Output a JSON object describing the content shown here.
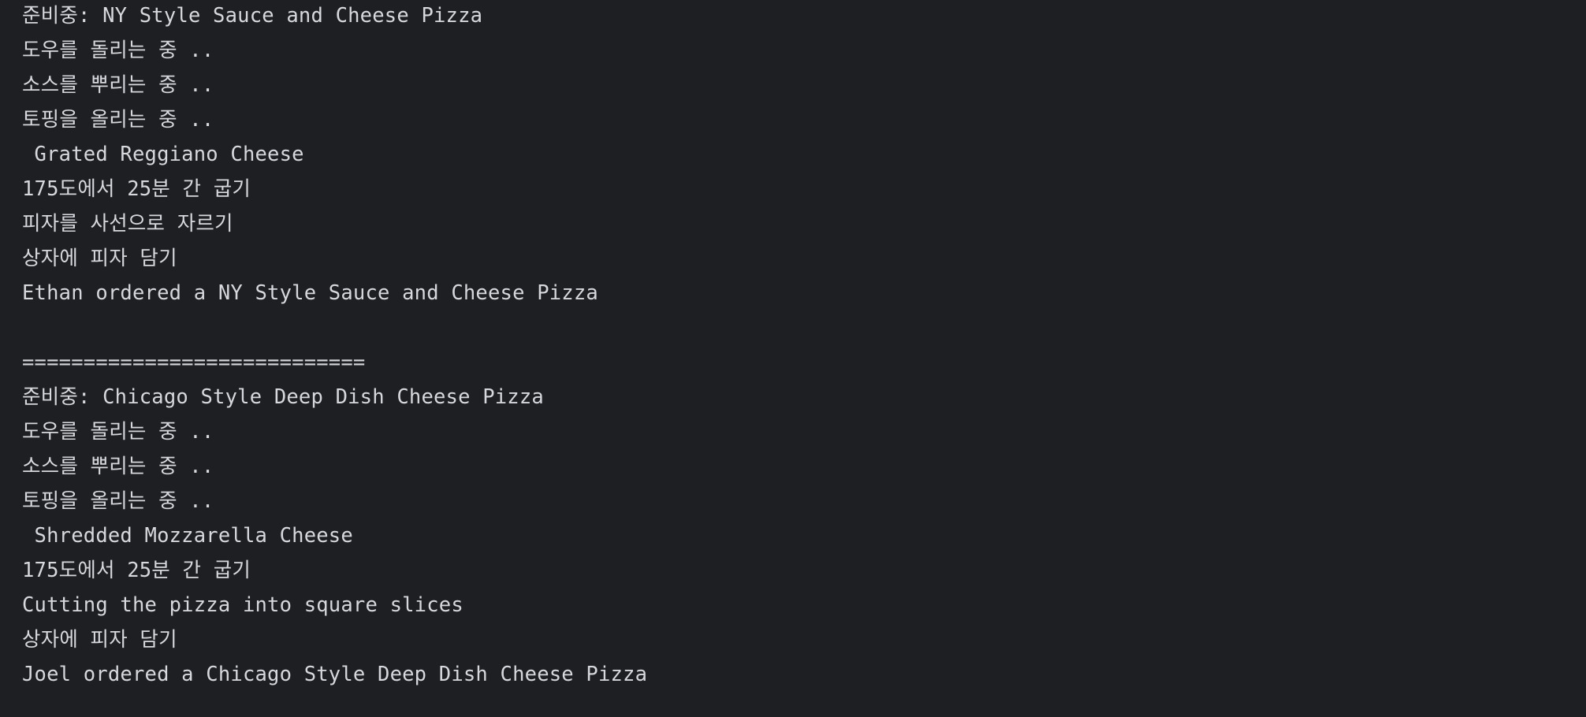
{
  "console": {
    "lines": [
      "준비중: NY Style Sauce and Cheese Pizza",
      "도우를 돌리는 중 ..",
      "소스를 뿌리는 중 ..",
      "토핑을 올리는 중 ..",
      " Grated Reggiano Cheese",
      "175도에서 25분 간 굽기",
      "피자를 사선으로 자르기",
      "상자에 피자 담기",
      "Ethan ordered a NY Style Sauce and Cheese Pizza",
      "",
      "============================",
      "준비중: Chicago Style Deep Dish Cheese Pizza",
      "도우를 돌리는 중 ..",
      "소스를 뿌리는 중 ..",
      "토핑을 올리는 중 ..",
      " Shredded Mozzarella Cheese",
      "175도에서 25분 간 굽기",
      "Cutting the pizza into square slices",
      "상자에 피자 담기",
      "Joel ordered a Chicago Style Deep Dish Cheese Pizza"
    ]
  }
}
